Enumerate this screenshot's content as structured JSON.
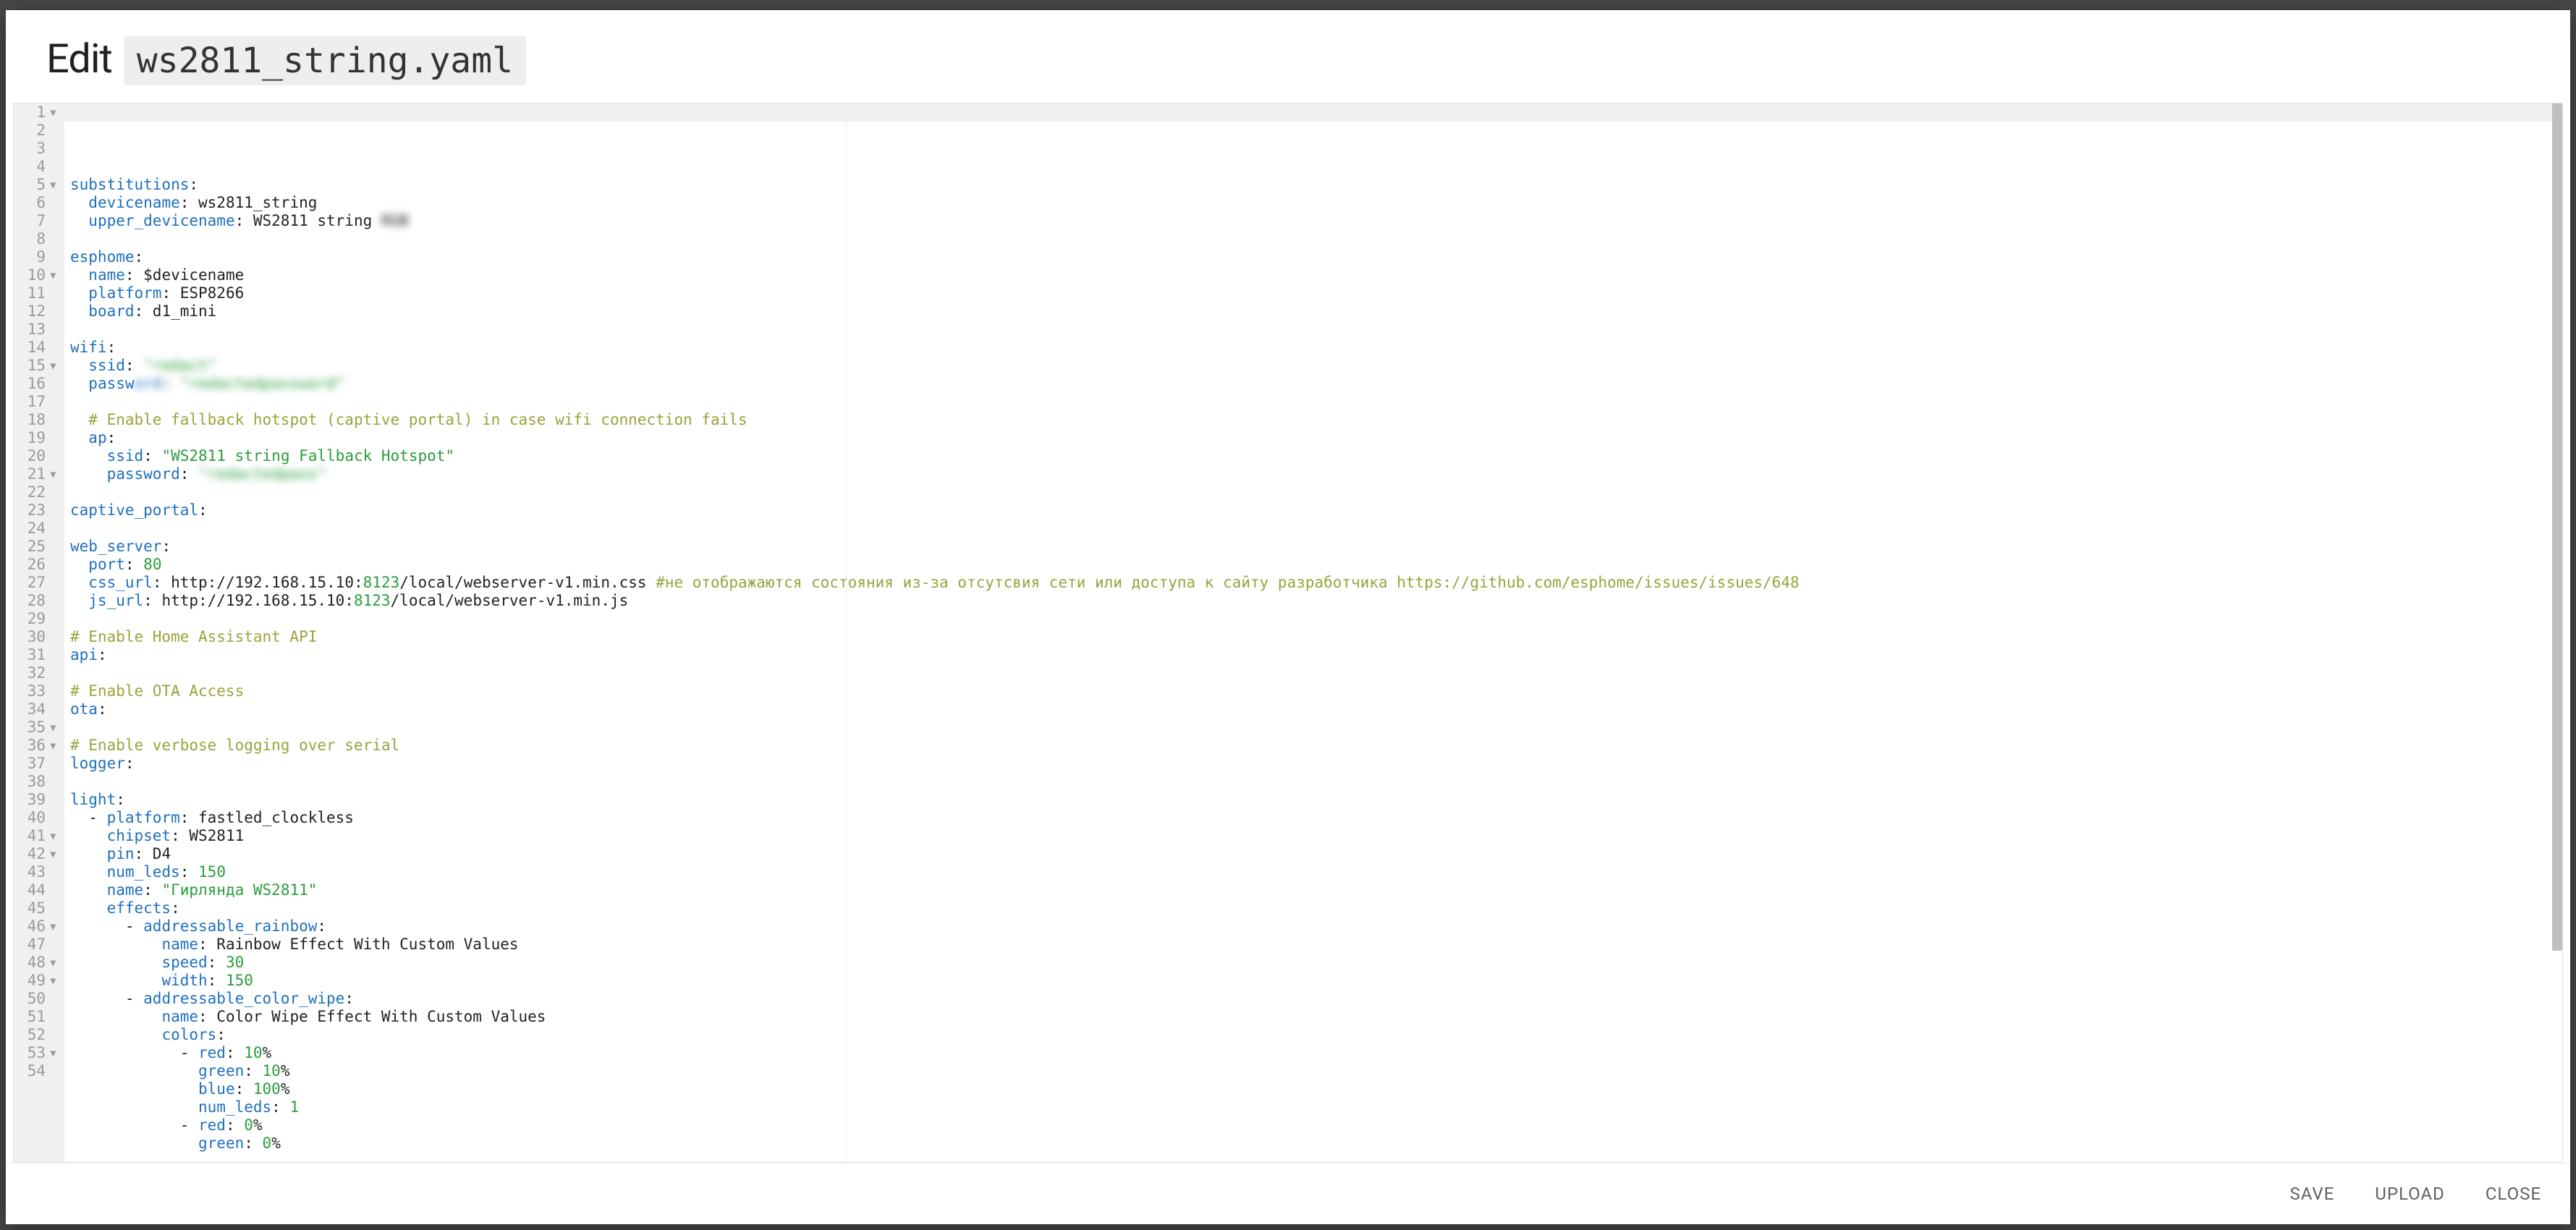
{
  "header": {
    "title": "Edit",
    "filename": "ws2811_string.yaml"
  },
  "footer": {
    "save": "SAVE",
    "upload": "UPLOAD",
    "close": "CLOSE"
  },
  "editor": {
    "active_line_index": 0,
    "lines": [
      {
        "n": 1,
        "fold": true,
        "tokens": [
          {
            "c": "key",
            "t": "substitutions"
          },
          {
            "c": "plain",
            "t": ":"
          }
        ]
      },
      {
        "n": 2,
        "fold": false,
        "tokens": [
          {
            "c": "plain",
            "t": "  "
          },
          {
            "c": "key",
            "t": "devicename"
          },
          {
            "c": "plain",
            "t": ": ws2811_string"
          }
        ]
      },
      {
        "n": 3,
        "fold": false,
        "tokens": [
          {
            "c": "plain",
            "t": "  "
          },
          {
            "c": "key",
            "t": "upper_devicename"
          },
          {
            "c": "plain",
            "t": ": WS2811 string "
          },
          {
            "c": "plain",
            "t": "RGB",
            "blur": true
          }
        ]
      },
      {
        "n": 4,
        "fold": false,
        "tokens": []
      },
      {
        "n": 5,
        "fold": true,
        "tokens": [
          {
            "c": "key",
            "t": "esphome"
          },
          {
            "c": "plain",
            "t": ":"
          }
        ]
      },
      {
        "n": 6,
        "fold": false,
        "tokens": [
          {
            "c": "plain",
            "t": "  "
          },
          {
            "c": "key",
            "t": "name"
          },
          {
            "c": "plain",
            "t": ": $devicename"
          }
        ]
      },
      {
        "n": 7,
        "fold": false,
        "tokens": [
          {
            "c": "plain",
            "t": "  "
          },
          {
            "c": "key",
            "t": "platform"
          },
          {
            "c": "plain",
            "t": ": ESP8266"
          }
        ]
      },
      {
        "n": 8,
        "fold": false,
        "tokens": [
          {
            "c": "plain",
            "t": "  "
          },
          {
            "c": "key",
            "t": "board"
          },
          {
            "c": "plain",
            "t": ": d1_mini"
          }
        ]
      },
      {
        "n": 9,
        "fold": false,
        "tokens": []
      },
      {
        "n": 10,
        "fold": true,
        "tokens": [
          {
            "c": "key",
            "t": "wifi"
          },
          {
            "c": "plain",
            "t": ":"
          }
        ]
      },
      {
        "n": 11,
        "fold": false,
        "tokens": [
          {
            "c": "plain",
            "t": "  "
          },
          {
            "c": "key",
            "t": "ssid"
          },
          {
            "c": "plain",
            "t": ": "
          },
          {
            "c": "str",
            "t": "\"redact\"",
            "blur": true
          }
        ]
      },
      {
        "n": 12,
        "fold": false,
        "tokens": [
          {
            "c": "plain",
            "t": "  "
          },
          {
            "c": "key",
            "t": "passw"
          },
          {
            "c": "key",
            "t": "ord",
            "blur": true
          },
          {
            "c": "plain",
            "t": ": ",
            "blur": true
          },
          {
            "c": "str",
            "t": "\"redactedpassword\"",
            "blur": true
          }
        ]
      },
      {
        "n": 13,
        "fold": false,
        "tokens": []
      },
      {
        "n": 14,
        "fold": false,
        "tokens": [
          {
            "c": "plain",
            "t": "  "
          },
          {
            "c": "com",
            "t": "# Enable fallback hotspot (captive portal) in case wifi connection fails"
          }
        ]
      },
      {
        "n": 15,
        "fold": true,
        "tokens": [
          {
            "c": "plain",
            "t": "  "
          },
          {
            "c": "key",
            "t": "ap"
          },
          {
            "c": "plain",
            "t": ":"
          }
        ]
      },
      {
        "n": 16,
        "fold": false,
        "tokens": [
          {
            "c": "plain",
            "t": "    "
          },
          {
            "c": "key",
            "t": "ssid"
          },
          {
            "c": "plain",
            "t": ": "
          },
          {
            "c": "str",
            "t": "\"WS2811 string Fallback Hotspot\""
          }
        ]
      },
      {
        "n": 17,
        "fold": false,
        "tokens": [
          {
            "c": "plain",
            "t": "    "
          },
          {
            "c": "key",
            "t": "password"
          },
          {
            "c": "plain",
            "t": ": "
          },
          {
            "c": "str",
            "t": "\"redactedpass\"",
            "blur": true
          }
        ]
      },
      {
        "n": 18,
        "fold": false,
        "tokens": []
      },
      {
        "n": 19,
        "fold": false,
        "tokens": [
          {
            "c": "key",
            "t": "captive_portal"
          },
          {
            "c": "plain",
            "t": ":"
          }
        ]
      },
      {
        "n": 20,
        "fold": false,
        "tokens": []
      },
      {
        "n": 21,
        "fold": true,
        "tokens": [
          {
            "c": "key",
            "t": "web_server"
          },
          {
            "c": "plain",
            "t": ":"
          }
        ]
      },
      {
        "n": 22,
        "fold": false,
        "tokens": [
          {
            "c": "plain",
            "t": "  "
          },
          {
            "c": "key",
            "t": "port"
          },
          {
            "c": "plain",
            "t": ": "
          },
          {
            "c": "num",
            "t": "80"
          }
        ]
      },
      {
        "n": 23,
        "fold": false,
        "tokens": [
          {
            "c": "plain",
            "t": "  "
          },
          {
            "c": "key",
            "t": "css_url"
          },
          {
            "c": "plain",
            "t": ": http://192.168.15.10:"
          },
          {
            "c": "num",
            "t": "8123"
          },
          {
            "c": "plain",
            "t": "/local/webserver-v1.min.css "
          },
          {
            "c": "com",
            "t": "#не отображаются состояния из-за отсутсвия сети или доступа к сайту разработчика https://github.com/esphome/issues/issues/648"
          }
        ]
      },
      {
        "n": 24,
        "fold": false,
        "tokens": [
          {
            "c": "plain",
            "t": "  "
          },
          {
            "c": "key",
            "t": "js_url"
          },
          {
            "c": "plain",
            "t": ": http://192.168.15.10:"
          },
          {
            "c": "num",
            "t": "8123"
          },
          {
            "c": "plain",
            "t": "/local/webserver-v1.min.js"
          }
        ]
      },
      {
        "n": 25,
        "fold": false,
        "tokens": []
      },
      {
        "n": 26,
        "fold": false,
        "tokens": [
          {
            "c": "com",
            "t": "# Enable Home Assistant API"
          }
        ]
      },
      {
        "n": 27,
        "fold": false,
        "tokens": [
          {
            "c": "key",
            "t": "api"
          },
          {
            "c": "plain",
            "t": ":"
          }
        ]
      },
      {
        "n": 28,
        "fold": false,
        "tokens": []
      },
      {
        "n": 29,
        "fold": false,
        "tokens": [
          {
            "c": "com",
            "t": "# Enable OTA Access"
          }
        ]
      },
      {
        "n": 30,
        "fold": false,
        "tokens": [
          {
            "c": "key",
            "t": "ota"
          },
          {
            "c": "plain",
            "t": ":"
          }
        ]
      },
      {
        "n": 31,
        "fold": false,
        "tokens": []
      },
      {
        "n": 32,
        "fold": false,
        "tokens": [
          {
            "c": "com",
            "t": "# Enable verbose logging over serial"
          }
        ]
      },
      {
        "n": 33,
        "fold": false,
        "tokens": [
          {
            "c": "key",
            "t": "logger"
          },
          {
            "c": "plain",
            "t": ":"
          }
        ]
      },
      {
        "n": 34,
        "fold": false,
        "tokens": []
      },
      {
        "n": 35,
        "fold": true,
        "tokens": [
          {
            "c": "key",
            "t": "light"
          },
          {
            "c": "plain",
            "t": ":"
          }
        ]
      },
      {
        "n": 36,
        "fold": true,
        "tokens": [
          {
            "c": "plain",
            "t": "  - "
          },
          {
            "c": "key",
            "t": "platform"
          },
          {
            "c": "plain",
            "t": ": fastled_clockless"
          }
        ]
      },
      {
        "n": 37,
        "fold": false,
        "tokens": [
          {
            "c": "plain",
            "t": "    "
          },
          {
            "c": "key",
            "t": "chipset"
          },
          {
            "c": "plain",
            "t": ": WS2811"
          }
        ]
      },
      {
        "n": 38,
        "fold": false,
        "tokens": [
          {
            "c": "plain",
            "t": "    "
          },
          {
            "c": "key",
            "t": "pin"
          },
          {
            "c": "plain",
            "t": ": D4"
          }
        ]
      },
      {
        "n": 39,
        "fold": false,
        "tokens": [
          {
            "c": "plain",
            "t": "    "
          },
          {
            "c": "key",
            "t": "num_leds"
          },
          {
            "c": "plain",
            "t": ": "
          },
          {
            "c": "num",
            "t": "150"
          }
        ]
      },
      {
        "n": 40,
        "fold": false,
        "tokens": [
          {
            "c": "plain",
            "t": "    "
          },
          {
            "c": "key",
            "t": "name"
          },
          {
            "c": "plain",
            "t": ": "
          },
          {
            "c": "str",
            "t": "\"Гирлянда WS2811\""
          }
        ]
      },
      {
        "n": 41,
        "fold": true,
        "tokens": [
          {
            "c": "plain",
            "t": "    "
          },
          {
            "c": "key",
            "t": "effects"
          },
          {
            "c": "plain",
            "t": ":"
          }
        ]
      },
      {
        "n": 42,
        "fold": true,
        "tokens": [
          {
            "c": "plain",
            "t": "      - "
          },
          {
            "c": "key",
            "t": "addressable_rainbow"
          },
          {
            "c": "plain",
            "t": ":"
          }
        ]
      },
      {
        "n": 43,
        "fold": false,
        "tokens": [
          {
            "c": "plain",
            "t": "          "
          },
          {
            "c": "key",
            "t": "name"
          },
          {
            "c": "plain",
            "t": ": Rainbow Effect With Custom Values"
          }
        ]
      },
      {
        "n": 44,
        "fold": false,
        "tokens": [
          {
            "c": "plain",
            "t": "          "
          },
          {
            "c": "key",
            "t": "speed"
          },
          {
            "c": "plain",
            "t": ": "
          },
          {
            "c": "num",
            "t": "30"
          }
        ]
      },
      {
        "n": 45,
        "fold": false,
        "tokens": [
          {
            "c": "plain",
            "t": "          "
          },
          {
            "c": "key",
            "t": "width"
          },
          {
            "c": "plain",
            "t": ": "
          },
          {
            "c": "num",
            "t": "150"
          }
        ]
      },
      {
        "n": 46,
        "fold": true,
        "tokens": [
          {
            "c": "plain",
            "t": "      - "
          },
          {
            "c": "key",
            "t": "addressable_color_wipe"
          },
          {
            "c": "plain",
            "t": ":"
          }
        ]
      },
      {
        "n": 47,
        "fold": false,
        "tokens": [
          {
            "c": "plain",
            "t": "          "
          },
          {
            "c": "key",
            "t": "name"
          },
          {
            "c": "plain",
            "t": ": Color Wipe Effect With Custom Values"
          }
        ]
      },
      {
        "n": 48,
        "fold": true,
        "tokens": [
          {
            "c": "plain",
            "t": "          "
          },
          {
            "c": "key",
            "t": "colors"
          },
          {
            "c": "plain",
            "t": ":"
          }
        ]
      },
      {
        "n": 49,
        "fold": true,
        "tokens": [
          {
            "c": "plain",
            "t": "            - "
          },
          {
            "c": "key",
            "t": "red"
          },
          {
            "c": "plain",
            "t": ": "
          },
          {
            "c": "num",
            "t": "10"
          },
          {
            "c": "plain",
            "t": "%"
          }
        ]
      },
      {
        "n": 50,
        "fold": false,
        "tokens": [
          {
            "c": "plain",
            "t": "              "
          },
          {
            "c": "key",
            "t": "green"
          },
          {
            "c": "plain",
            "t": ": "
          },
          {
            "c": "num",
            "t": "10"
          },
          {
            "c": "plain",
            "t": "%"
          }
        ]
      },
      {
        "n": 51,
        "fold": false,
        "tokens": [
          {
            "c": "plain",
            "t": "              "
          },
          {
            "c": "key",
            "t": "blue"
          },
          {
            "c": "plain",
            "t": ": "
          },
          {
            "c": "num",
            "t": "100"
          },
          {
            "c": "plain",
            "t": "%"
          }
        ]
      },
      {
        "n": 52,
        "fold": false,
        "tokens": [
          {
            "c": "plain",
            "t": "              "
          },
          {
            "c": "key",
            "t": "num_leds"
          },
          {
            "c": "plain",
            "t": ": "
          },
          {
            "c": "num",
            "t": "1"
          }
        ]
      },
      {
        "n": 53,
        "fold": true,
        "tokens": [
          {
            "c": "plain",
            "t": "            - "
          },
          {
            "c": "key",
            "t": "red"
          },
          {
            "c": "plain",
            "t": ": "
          },
          {
            "c": "num",
            "t": "0"
          },
          {
            "c": "plain",
            "t": "%"
          }
        ]
      },
      {
        "n": 54,
        "fold": false,
        "tokens": [
          {
            "c": "plain",
            "t": "              "
          },
          {
            "c": "key",
            "t": "green"
          },
          {
            "c": "plain",
            "t": ": "
          },
          {
            "c": "num",
            "t": "0"
          },
          {
            "c": "plain",
            "t": "%"
          }
        ]
      }
    ]
  }
}
